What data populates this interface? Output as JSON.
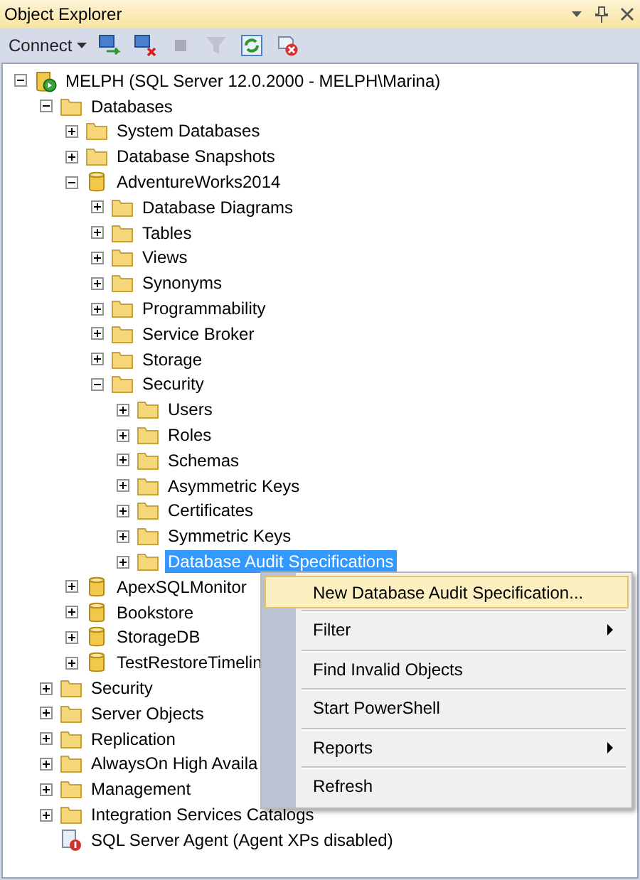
{
  "window": {
    "title": "Object Explorer"
  },
  "toolbar": {
    "connect_label": "Connect",
    "buttons": [
      {
        "kind": "connect",
        "disabled": false
      },
      {
        "kind": "disconnect",
        "disabled": false
      },
      {
        "kind": "stop",
        "disabled": true
      },
      {
        "kind": "filter",
        "disabled": true
      },
      {
        "kind": "refresh",
        "disabled": false
      },
      {
        "kind": "close-script",
        "disabled": false
      }
    ]
  },
  "tree": [
    {
      "label": "MELPH (SQL Server 12.0.2000 - MELPH\\Marina)",
      "kind": "server",
      "expanded": true,
      "selected": false,
      "children": [
        {
          "label": "Databases",
          "kind": "folder",
          "expanded": true,
          "selected": false,
          "children": [
            {
              "label": "System Databases",
              "kind": "folder",
              "expanded": false,
              "selected": false
            },
            {
              "label": "Database Snapshots",
              "kind": "folder",
              "expanded": false,
              "selected": false
            },
            {
              "label": "AdventureWorks2014",
              "kind": "database",
              "expanded": true,
              "selected": false,
              "children": [
                {
                  "label": "Database Diagrams",
                  "kind": "folder",
                  "expanded": false,
                  "selected": false
                },
                {
                  "label": "Tables",
                  "kind": "folder",
                  "expanded": false,
                  "selected": false
                },
                {
                  "label": "Views",
                  "kind": "folder",
                  "expanded": false,
                  "selected": false
                },
                {
                  "label": "Synonyms",
                  "kind": "folder",
                  "expanded": false,
                  "selected": false
                },
                {
                  "label": "Programmability",
                  "kind": "folder",
                  "expanded": false,
                  "selected": false
                },
                {
                  "label": "Service Broker",
                  "kind": "folder",
                  "expanded": false,
                  "selected": false
                },
                {
                  "label": "Storage",
                  "kind": "folder",
                  "expanded": false,
                  "selected": false
                },
                {
                  "label": "Security",
                  "kind": "folder",
                  "expanded": true,
                  "selected": false,
                  "children": [
                    {
                      "label": "Users",
                      "kind": "folder",
                      "expanded": false,
                      "selected": false
                    },
                    {
                      "label": "Roles",
                      "kind": "folder",
                      "expanded": false,
                      "selected": false
                    },
                    {
                      "label": "Schemas",
                      "kind": "folder",
                      "expanded": false,
                      "selected": false
                    },
                    {
                      "label": "Asymmetric Keys",
                      "kind": "folder",
                      "expanded": false,
                      "selected": false
                    },
                    {
                      "label": "Certificates",
                      "kind": "folder",
                      "expanded": false,
                      "selected": false
                    },
                    {
                      "label": "Symmetric Keys",
                      "kind": "folder",
                      "expanded": false,
                      "selected": false
                    },
                    {
                      "label": "Database Audit Specifications",
                      "kind": "folder",
                      "expanded": false,
                      "selected": true
                    }
                  ]
                }
              ]
            },
            {
              "label": "ApexSQLMonitor",
              "kind": "database",
              "expanded": false,
              "selected": false
            },
            {
              "label": "Bookstore",
              "kind": "database",
              "expanded": false,
              "selected": false
            },
            {
              "label": "StorageDB",
              "kind": "database",
              "expanded": false,
              "selected": false
            },
            {
              "label": "TestRestoreTimelin",
              "kind": "database",
              "expanded": false,
              "selected": false
            }
          ]
        },
        {
          "label": "Security",
          "kind": "folder",
          "expanded": false,
          "selected": false
        },
        {
          "label": "Server Objects",
          "kind": "folder",
          "expanded": false,
          "selected": false
        },
        {
          "label": "Replication",
          "kind": "folder",
          "expanded": false,
          "selected": false
        },
        {
          "label": "AlwaysOn High Availa",
          "kind": "folder",
          "expanded": false,
          "selected": false
        },
        {
          "label": "Management",
          "kind": "folder",
          "expanded": false,
          "selected": false
        },
        {
          "label": "Integration Services Catalogs",
          "kind": "folder",
          "expanded": false,
          "selected": false
        },
        {
          "label": "SQL Server Agent (Agent XPs disabled)",
          "kind": "agent",
          "selected": false
        }
      ]
    }
  ],
  "context_menu": [
    {
      "label": "New Database Audit Specification...",
      "highlighted": true,
      "has_submenu": false
    },
    {
      "label": "Filter",
      "highlighted": false,
      "has_submenu": true
    },
    {
      "label": "Find Invalid Objects",
      "highlighted": false,
      "has_submenu": false
    },
    {
      "label": "Start PowerShell",
      "highlighted": false,
      "has_submenu": false
    },
    {
      "label": "Reports",
      "highlighted": false,
      "has_submenu": true
    },
    {
      "label": "Refresh",
      "highlighted": false,
      "has_submenu": false
    }
  ]
}
